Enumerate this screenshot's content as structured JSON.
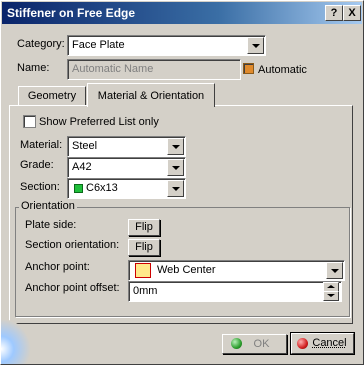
{
  "window": {
    "title": "Stiffener on Free Edge",
    "help_label": "?",
    "close_label": "X"
  },
  "category": {
    "label": "Category:",
    "value": "Face Plate"
  },
  "name": {
    "label": "Name:",
    "placeholder": "Automatic Name",
    "automatic_label": "Automatic",
    "automatic_checked": true
  },
  "tabs": [
    {
      "label": "Geometry"
    },
    {
      "label": "Material & Orientation",
      "active": true
    }
  ],
  "show_preferred": {
    "label": "Show Preferred List only",
    "checked": false
  },
  "material": {
    "label": "Material:",
    "value": "Steel"
  },
  "grade": {
    "label": "Grade:",
    "value": "A42"
  },
  "section": {
    "label": "Section:",
    "value": "C6x13"
  },
  "orientation": {
    "title": "Orientation",
    "plate_side_label": "Plate side:",
    "section_orientation_label": "Section orientation:",
    "flip_label": "Flip",
    "anchor_point_label": "Anchor point:",
    "anchor_point_value": "Web Center",
    "anchor_offset_label": "Anchor point offset:",
    "anchor_offset_value": "0mm"
  },
  "buttons": {
    "ok_label": "OK",
    "cancel_label": "Cancel"
  },
  "colors": {
    "accent_title": "#0a246a",
    "automatic_checkbox": "#e08a2c",
    "ok_icon": "#2e9e2e",
    "cancel_icon": "#d22020",
    "section_swatch": "#1fbf3a"
  }
}
